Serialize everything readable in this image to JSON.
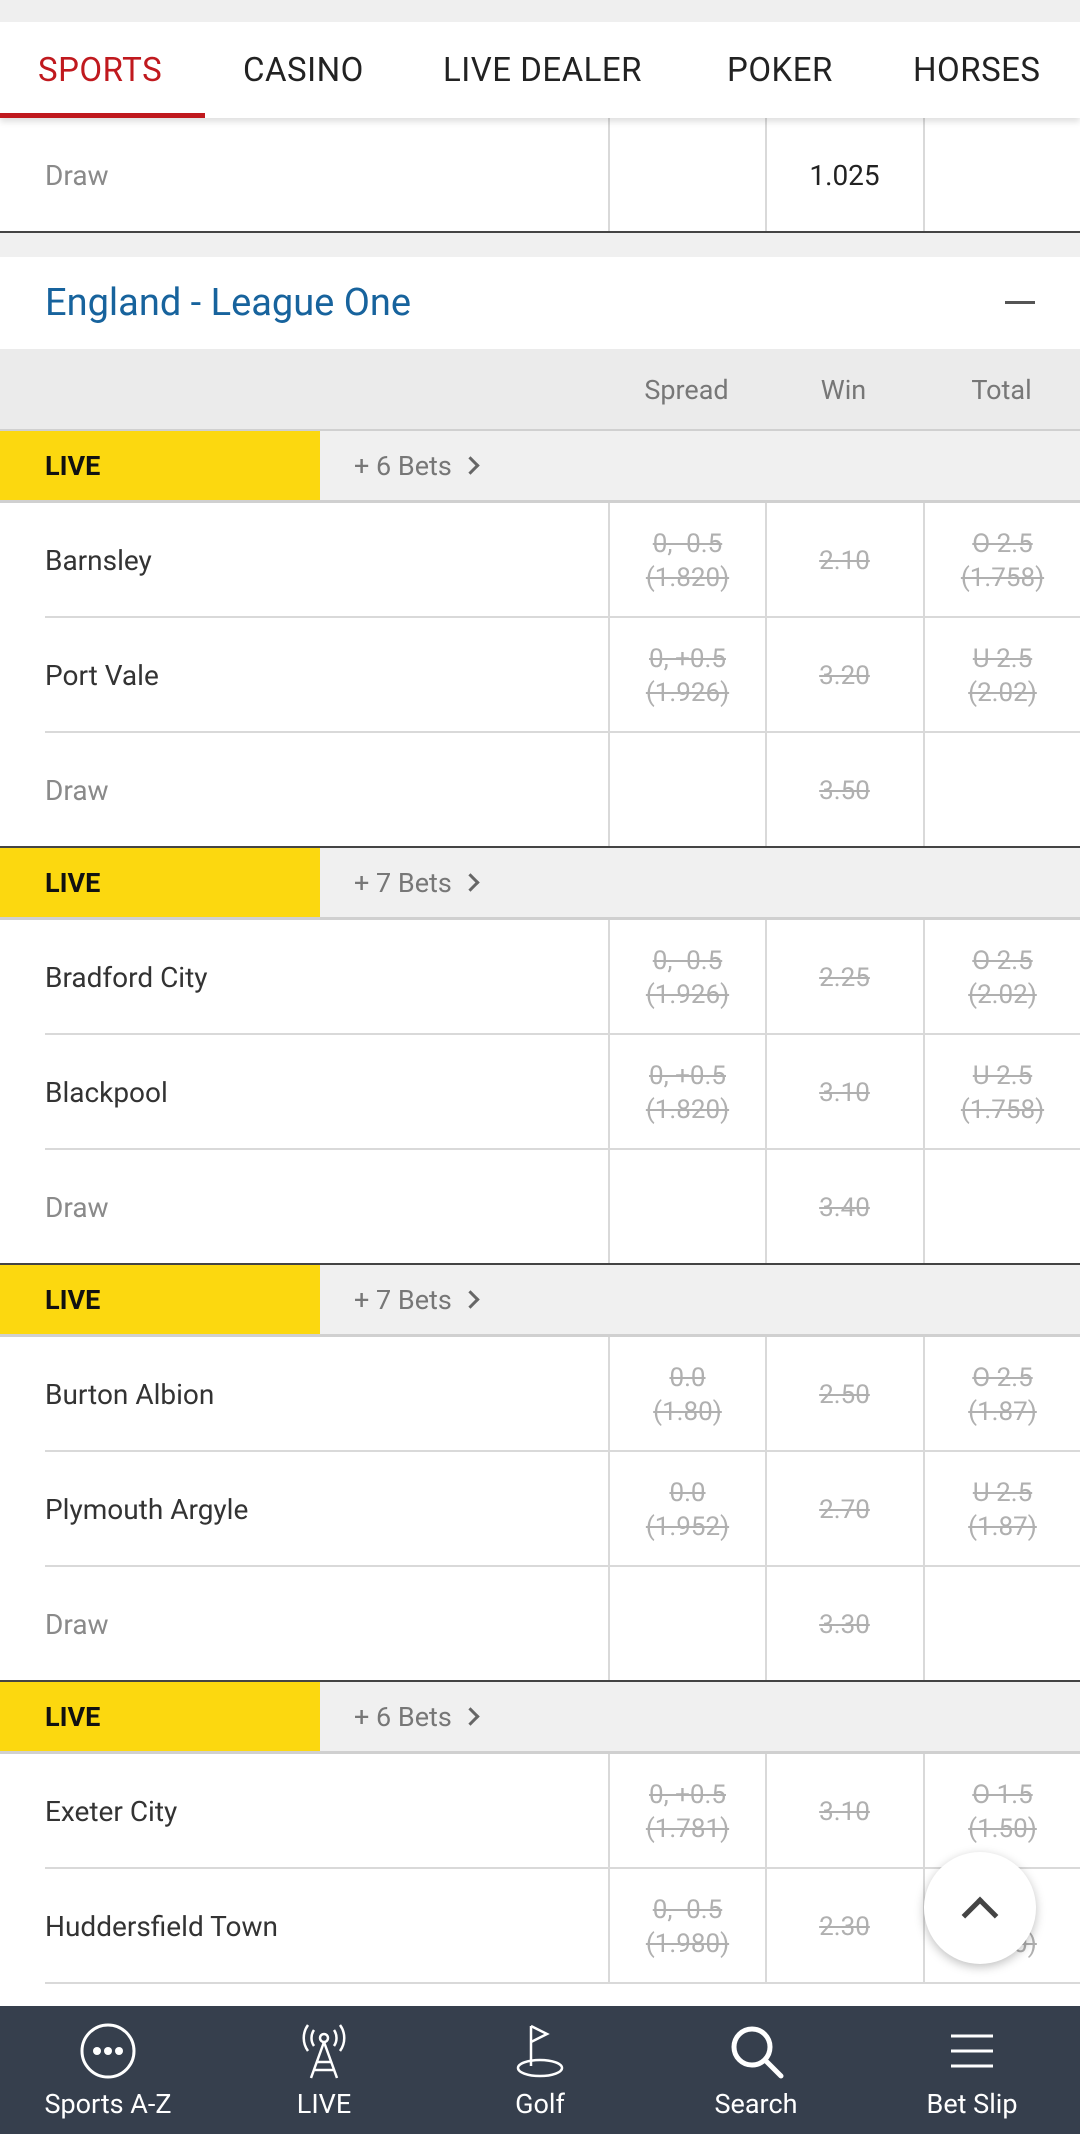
{
  "tabs": [
    "SPORTS",
    "CASINO",
    "LIVE DEALER",
    "POKER",
    "HORSES"
  ],
  "top_partial": {
    "name": "Draw",
    "win": "1.025"
  },
  "league": {
    "title": "England - League One"
  },
  "columns": {
    "spread": "Spread",
    "win": "Win",
    "total": "Total"
  },
  "live_label": "LIVE",
  "matches": [
    {
      "bets": "+ 6 Bets",
      "rows": [
        {
          "name": "Barnsley",
          "spread": [
            "0, -0.5",
            "(1.820)"
          ],
          "win": "2.10",
          "total": [
            "O 2.5",
            "(1.758)"
          ]
        },
        {
          "name": "Port Vale",
          "spread": [
            "0, +0.5",
            "(1.926)"
          ],
          "win": "3.20",
          "total": [
            "U 2.5",
            "(2.02)"
          ]
        },
        {
          "name": "Draw",
          "win": "3.50"
        }
      ]
    },
    {
      "bets": "+ 7 Bets",
      "rows": [
        {
          "name": "Bradford City",
          "spread": [
            "0, -0.5",
            "(1.926)"
          ],
          "win": "2.25",
          "total": [
            "O 2.5",
            "(2.02)"
          ]
        },
        {
          "name": "Blackpool",
          "spread": [
            "0, +0.5",
            "(1.820)"
          ],
          "win": "3.10",
          "total": [
            "U 2.5",
            "(1.758)"
          ]
        },
        {
          "name": "Draw",
          "win": "3.40"
        }
      ]
    },
    {
      "bets": "+ 7 Bets",
      "rows": [
        {
          "name": "Burton Albion",
          "spread": [
            "0.0",
            "(1.80)"
          ],
          "win": "2.50",
          "total": [
            "O 2.5",
            "(1.87)"
          ]
        },
        {
          "name": "Plymouth Argyle",
          "spread": [
            "0.0",
            "(1.952)"
          ],
          "win": "2.70",
          "total": [
            "U 2.5",
            "(1.87)"
          ]
        },
        {
          "name": "Draw",
          "win": "3.30"
        }
      ]
    },
    {
      "bets": "+ 6 Bets",
      "rows": [
        {
          "name": "Exeter City",
          "spread": [
            "0, +0.5",
            "(1.781)"
          ],
          "win": "3.10",
          "total": [
            "O 1.5",
            "(1.50)"
          ]
        },
        {
          "name": "Huddersfield Town",
          "spread": [
            "0, -0.5",
            "(1.980)"
          ],
          "win": "2.30",
          "total": [
            "U 1.5",
            "(2.50)"
          ]
        }
      ]
    }
  ],
  "bottom_nav": [
    {
      "label": "Sports A-Z",
      "icon": "dots-circle-icon"
    },
    {
      "label": "LIVE",
      "icon": "antenna-icon"
    },
    {
      "label": "Golf",
      "icon": "golf-flag-icon"
    },
    {
      "label": "Search",
      "icon": "search-icon"
    },
    {
      "label": "Bet Slip",
      "icon": "menu-lines-icon"
    }
  ],
  "colors": {
    "accent_red": "#c0191e",
    "league_blue": "#17639d",
    "live_yellow": "#fcd80f",
    "nav_dark": "#363f4d"
  }
}
